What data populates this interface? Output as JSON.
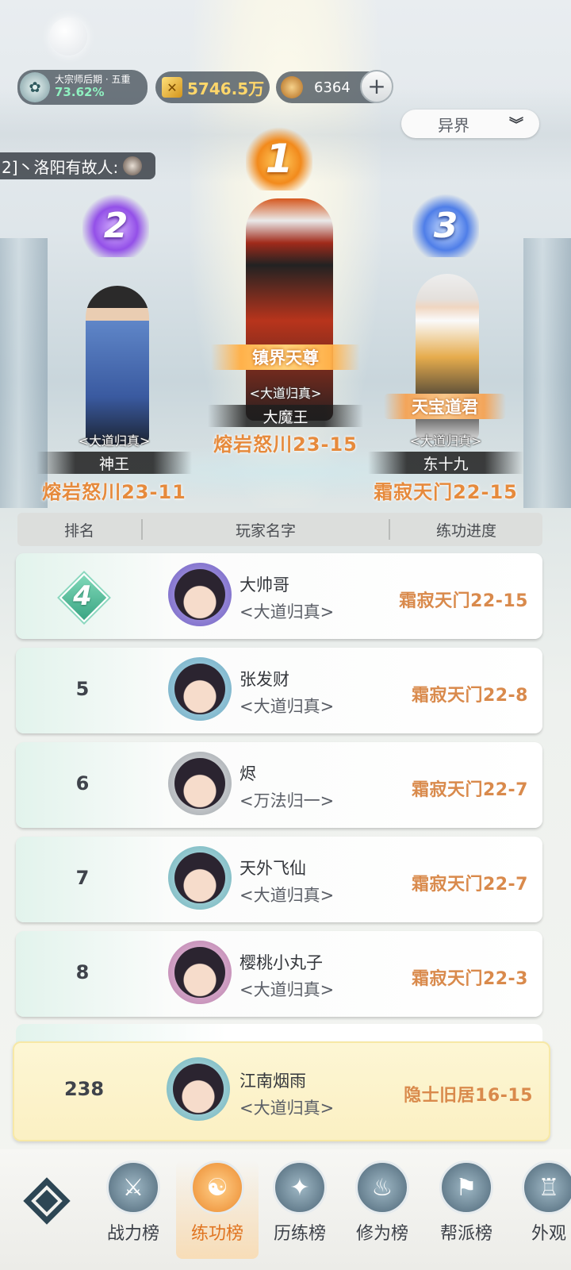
{
  "header": {
    "rank_name": "大宗师后期 · 五重",
    "rank_percent": "73.62%",
    "gold": "5746.5万",
    "jade": "6364",
    "plus_label": "+",
    "realm_select": "异界",
    "notice": "2]丶洛阳有故人:"
  },
  "podium": [
    {
      "rank": "1",
      "title": "镇界天尊",
      "realm": "<大道归真>",
      "name": "大魔王",
      "progress": "熔岩怒川23-15",
      "badge_color": "#f28a1c"
    },
    {
      "rank": "2",
      "title": "",
      "realm": "<大道归真>",
      "name": "神王",
      "progress": "熔岩怒川23-11",
      "badge_color": "#9350e8"
    },
    {
      "rank": "3",
      "title": "天宝道君",
      "realm": "<大道归真>",
      "name": "东十九",
      "progress": "霜寂天门22-15",
      "badge_color": "#4f7ee8"
    }
  ],
  "table": {
    "headers": [
      "排名",
      "玩家名字",
      "练功进度"
    ],
    "rows": [
      {
        "rank": "4",
        "name": "大帅哥",
        "realm": "<大道归真>",
        "progress": "霜寂天门22-15"
      },
      {
        "rank": "5",
        "name": "张发财",
        "realm": "<大道归真>",
        "progress": "霜寂天门22-8"
      },
      {
        "rank": "6",
        "name": "烬",
        "realm": "<万法归一>",
        "progress": "霜寂天门22-7"
      },
      {
        "rank": "7",
        "name": "天外飞仙",
        "realm": "<大道归真>",
        "progress": "霜寂天门22-7"
      },
      {
        "rank": "8",
        "name": "樱桃小丸子",
        "realm": "<大道归真>",
        "progress": "霜寂天门22-3"
      }
    ],
    "my_row": {
      "rank": "238",
      "name": "江南烟雨",
      "realm": "<大道归真>",
      "progress": "隐士旧居16-15"
    }
  },
  "nav": {
    "items": [
      {
        "label": "战力榜",
        "icon": "sword-icon"
      },
      {
        "label": "练功榜",
        "icon": "yin-yang-icon",
        "active": true
      },
      {
        "label": "历练榜",
        "icon": "compass-icon"
      },
      {
        "label": "修为榜",
        "icon": "cauldron-icon"
      },
      {
        "label": "帮派榜",
        "icon": "banner-icon"
      },
      {
        "label": "外观",
        "icon": "robe-icon"
      }
    ]
  },
  "colors": {
    "accent": "#ec8a2e",
    "progress_text": "#d98a4c",
    "rank4_badge": "#3aa583",
    "my_row_bg": "#fbf0c3"
  }
}
